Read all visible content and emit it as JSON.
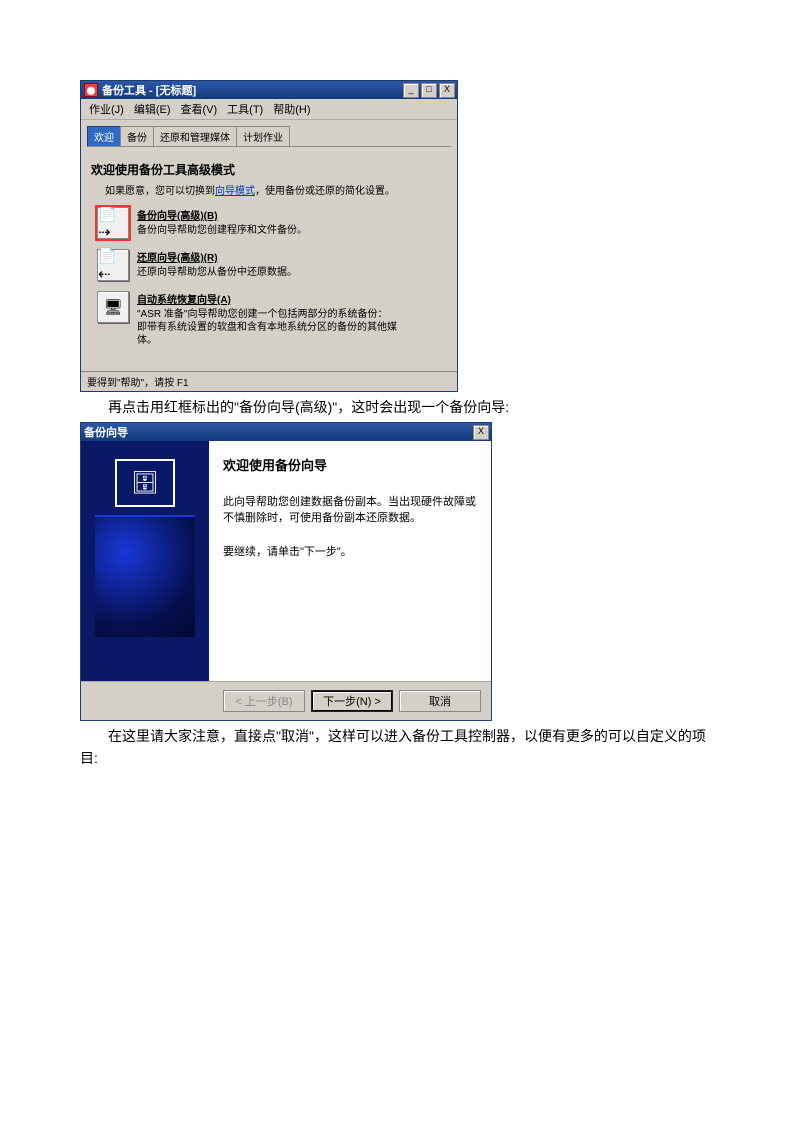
{
  "paragraphs": {
    "p1": "再点击用红框标出的\"备份向导(高级)\"，这时会出现一个备份向导:",
    "p2": "在这里请大家注意，直接点\"取消\"，这样可以进入备份工具控制器，以便有更多的可以自定义的项目:"
  },
  "window1": {
    "title": "备份工具 - [无标题]",
    "icon_glyph": "⬤",
    "win_btns": {
      "min": "_",
      "max": "□",
      "close": "X"
    },
    "menu": [
      "作业(J)",
      "编辑(E)",
      "查看(V)",
      "工具(T)",
      "帮助(H)"
    ],
    "tabs": [
      "欢迎",
      "备份",
      "还原和管理媒体",
      "计划作业"
    ],
    "active_tab_index": 0,
    "heading": "欢迎使用备份工具高级模式",
    "subtext_prefix": "如果愿意，您可以切换到",
    "subtext_link": "向导模式",
    "subtext_suffix": "，使用备份或还原的简化设置。",
    "options": [
      {
        "title": "备份向导(高级)(B)",
        "desc": "备份向导帮助您创建程序和文件备份。",
        "glyph": "📄⇢",
        "highlighted": true
      },
      {
        "title": "还原向导(高级)(R)",
        "desc": "还原向导帮助您从备份中还原数据。",
        "glyph": "📄⇠",
        "highlighted": false
      },
      {
        "title": "自动系统恢复向导(A)",
        "desc": "\"ASR 准备\"向导帮助您创建一个包括两部分的系统备份：即带有系统设置的软盘和含有本地系统分区的备份的其他媒体。",
        "glyph": "🖥",
        "highlighted": false
      }
    ],
    "status": "要得到\"帮助\"，请按 F1"
  },
  "dialog": {
    "title": "备份向导",
    "close": "X",
    "side_glyph": "🗄",
    "heading": "欢迎使用备份向导",
    "body1": "此向导帮助您创建数据备份副本。当出现硬件故障或不慎删除时，可使用备份副本还原数据。",
    "body2": "要继续，请单击\"下一步\"。",
    "buttons": {
      "back": "< 上一步(B)",
      "next": "下一步(N) >",
      "cancel": "取消"
    }
  }
}
